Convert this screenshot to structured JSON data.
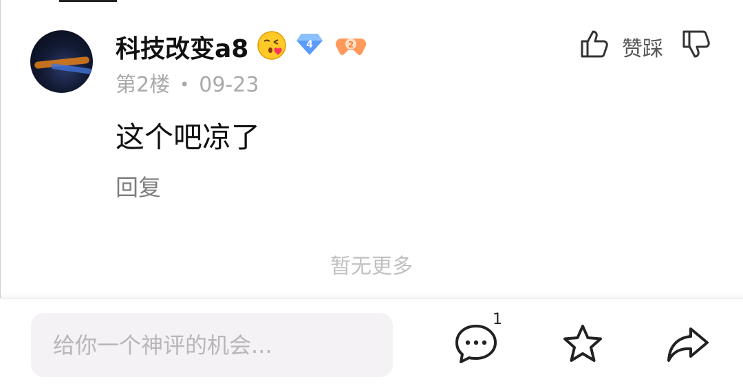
{
  "colors": {
    "text_primary": "#111111",
    "text_secondary": "#a9a9a9",
    "input_bg": "#f4f2f5",
    "level_badge": "#5b9bff",
    "emoji_face": "#ffca28",
    "game_badge": "#ff9a5c"
  },
  "post": {
    "username": "科技改变a8",
    "badges": {
      "emoji_icon": "kissing-face-emoji",
      "level": "4",
      "game_level": "2"
    },
    "floor": "第2楼",
    "separator": "•",
    "date": "09-23",
    "vote_label": "赞踩",
    "content": "这个吧凉了",
    "reply_label": "回复"
  },
  "list_end_text": "暂无更多",
  "bottom_bar": {
    "input_placeholder": "给你一个神评的机会...",
    "comments_count": "1",
    "icons": [
      "comment-icon",
      "star-icon",
      "share-icon"
    ]
  }
}
